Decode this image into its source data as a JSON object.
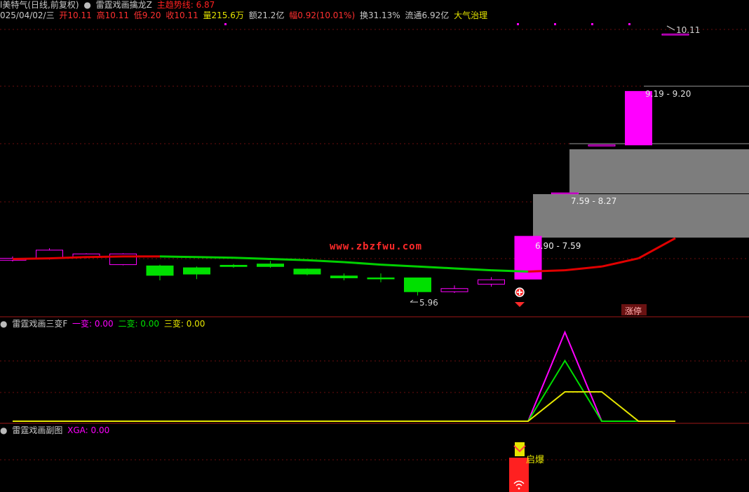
{
  "header": {
    "stock_name": "l美特气(日线,前复权)",
    "indicator_name": "雷霆戏画擒龙Z",
    "main_line_label": "主趋势线: 6.87",
    "date": "025/04/02/三",
    "open": "开10.11",
    "high": "高10.11",
    "low": "低9.20",
    "close": "收10.11",
    "volume": "量215.6万",
    "amount": "额21.2亿",
    "change": "幅0.92(10.01%)",
    "turnover": "换31.13%",
    "float": "流通6.92亿",
    "tag": "大气治理"
  },
  "sub1": {
    "title": "雷霆戏画三变F",
    "v1": "一变: 0.00",
    "v2": "二变: 0.00",
    "v3": "三变: 0.00"
  },
  "sub2": {
    "title": "雷霆戏画副图",
    "v1": "XGA: 0.00",
    "signal": "启爆"
  },
  "annotations": {
    "max_price": "10.11",
    "min_price": "5.96",
    "zone_top": "9.19 - 9.20",
    "zone_mid": "7.59 - 8.27",
    "zone_low": "6.90 - 7.59",
    "limit_up": "涨停",
    "watermark": "www.zbzfwu.com"
  },
  "colors": {
    "up": "#ff00ff",
    "down": "#00e000",
    "trend_up": "#e00000",
    "trend_down": "#00d000",
    "zone": "#808080",
    "yellow": "#e6e600",
    "grid": "#7a1010"
  },
  "chart_data": {
    "type": "candlestick",
    "price_axis": [
      5.7,
      10.25
    ],
    "candles": [
      {
        "open": 6.52,
        "close": 6.55,
        "high": 6.58,
        "low": 6.5
      },
      {
        "open": 6.55,
        "close": 6.68,
        "high": 6.71,
        "low": 6.53
      },
      {
        "open": 6.57,
        "close": 6.62,
        "high": 6.63,
        "low": 6.55
      },
      {
        "open": 6.45,
        "close": 6.62,
        "high": 6.63,
        "low": 6.44
      },
      {
        "open": 6.43,
        "close": 6.28,
        "high": 6.45,
        "low": 6.2
      },
      {
        "open": 6.4,
        "close": 6.3,
        "high": 6.42,
        "low": 6.22
      },
      {
        "open": 6.44,
        "close": 6.42,
        "high": 6.46,
        "low": 6.4
      },
      {
        "open": 6.46,
        "close": 6.42,
        "high": 6.51,
        "low": 6.4
      },
      {
        "open": 6.38,
        "close": 6.3,
        "high": 6.39,
        "low": 6.28
      },
      {
        "open": 6.27,
        "close": 6.24,
        "high": 6.31,
        "low": 6.2
      },
      {
        "open": 6.24,
        "close": 6.23,
        "high": 6.31,
        "low": 6.17
      },
      {
        "open": 6.24,
        "close": 6.02,
        "high": 6.24,
        "low": 5.96
      },
      {
        "open": 6.02,
        "close": 6.07,
        "high": 6.12,
        "low": 6.0
      },
      {
        "open": 6.14,
        "close": 6.21,
        "high": 6.25,
        "low": 6.1
      },
      {
        "open": 6.22,
        "close": 6.9,
        "high": 6.9,
        "low": 6.22
      },
      {
        "open": 7.59,
        "close": 7.59,
        "high": 7.59,
        "low": 7.59
      },
      {
        "open": 8.35,
        "close": 8.35,
        "high": 8.35,
        "low": 8.35
      },
      {
        "open": 8.35,
        "close": 9.2,
        "high": 9.2,
        "low": 8.35
      },
      {
        "open": 10.11,
        "close": 10.11,
        "high": 10.11,
        "low": 10.11
      }
    ],
    "trend_line": [
      6.54,
      6.55,
      6.57,
      6.58,
      6.58,
      6.57,
      6.56,
      6.54,
      6.52,
      6.49,
      6.45,
      6.42,
      6.39,
      6.36,
      6.34,
      6.36,
      6.42,
      6.55,
      6.87
    ],
    "sub1_series": [
      {
        "name": "一变",
        "values": [
          0,
          0,
          0,
          0,
          0,
          0,
          0,
          0,
          0,
          0,
          0,
          0,
          0,
          0,
          0,
          1,
          0,
          0,
          0
        ]
      },
      {
        "name": "二变",
        "values": [
          0,
          0,
          0,
          0,
          0,
          0,
          0,
          0,
          0,
          0,
          0,
          0,
          0,
          0,
          0,
          0.68,
          0,
          0,
          0
        ]
      },
      {
        "name": "三变",
        "values": [
          0,
          0,
          0,
          0,
          0,
          0,
          0,
          0,
          0,
          0,
          0,
          0,
          0,
          0,
          0,
          0.33,
          0.33,
          0,
          0
        ]
      }
    ]
  }
}
